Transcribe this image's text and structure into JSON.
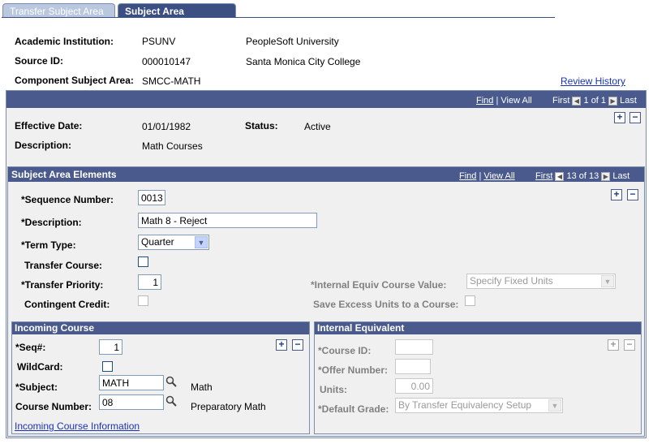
{
  "tabs": [
    {
      "label": "Transfer Subject Area"
    },
    {
      "label": "Subject Area Elements"
    }
  ],
  "header": {
    "institution_label": "Academic Institution:",
    "institution_code": "PSUNV",
    "institution_name": "PeopleSoft University",
    "source_label": "Source ID:",
    "source_id": "000010147",
    "source_name": "Santa Monica City College",
    "component_label": "Component Subject Area:",
    "component_value": "SMCC-MATH",
    "review_history": "Review History"
  },
  "outer_nav": {
    "find": "Find",
    "sep": "|",
    "view_all": "View All",
    "first": "First",
    "count": "1 of 1",
    "last": "Last"
  },
  "effective": {
    "date_label": "Effective Date:",
    "date_value": "01/01/1982",
    "status_label": "Status:",
    "status_value": "Active",
    "desc_label": "Description:",
    "desc_value": "Math Courses"
  },
  "elements": {
    "title": "Subject Area Elements",
    "nav": {
      "find": "Find",
      "sep": "|",
      "view_all": "View All",
      "first": "First",
      "count": "13 of 13",
      "last": "Last"
    },
    "seq_label": "*Sequence Number:",
    "seq_value": "0013",
    "desc_label": "*Description:",
    "desc_value": "Math 8 - Reject",
    "term_label": "*Term Type:",
    "term_value": "Quarter",
    "transfer_course_label": "Transfer Course:",
    "priority_label": "*Transfer Priority:",
    "priority_value": "1",
    "contingent_label": "Contingent Credit:",
    "internal_equiv_label": "*Internal Equiv Course Value:",
    "internal_equiv_value": "Specify Fixed Units",
    "save_excess_label": "Save Excess Units to a Course:"
  },
  "incoming": {
    "title": "Incoming Course",
    "seq_label": "*Seq#:",
    "seq_value": "1",
    "wildcard_label": "WildCard:",
    "subject_label": "*Subject:",
    "subject_value": "MATH",
    "subject_desc": "Math",
    "course_num_label": "Course Number:",
    "course_num_value": "08",
    "course_desc": "Preparatory Math",
    "info_link": "Incoming Course Information"
  },
  "internal": {
    "title": "Internal Equivalent",
    "course_id_label": "*Course ID:",
    "offer_label": "*Offer Number:",
    "units_label": "Units:",
    "units_value": "0.00",
    "grade_label": "*Default Grade:",
    "grade_value": "By Transfer Equivalency Setup"
  },
  "icons": {
    "plus": "+",
    "minus": "−",
    "prev": "◀",
    "next": "▶",
    "dropdown": "▼"
  }
}
